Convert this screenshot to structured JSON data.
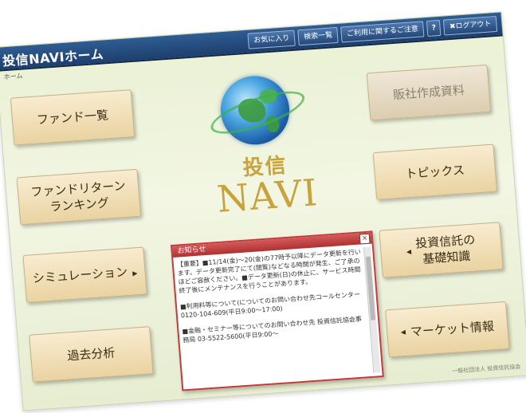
{
  "app": {
    "title": "投信NAVIホーム",
    "breadcrumb": "ホーム"
  },
  "toolbar": {
    "items": [
      {
        "label": "お気に入り"
      },
      {
        "label": "検索一覧"
      },
      {
        "label": "ご利用に関するご注意"
      },
      {
        "label": "?"
      },
      {
        "label": "✖ログアウト"
      }
    ]
  },
  "left_menu": [
    {
      "label": "ファンド一覧"
    },
    {
      "label": "ファンドリターン\nランキング"
    },
    {
      "label": "シミュレーション"
    },
    {
      "label": "過去分析"
    }
  ],
  "right_menu": [
    {
      "label": "販社作成資料"
    },
    {
      "label": "トピックス"
    },
    {
      "label": "投資信託の\n基礎知識"
    },
    {
      "label": "マーケット情報"
    }
  ],
  "logo": {
    "jp": "投信",
    "en": "NAVI"
  },
  "notice": {
    "title": "お知らせ",
    "close": "×",
    "paragraphs": [
      "【重要】■11/14(金)～20(金)の77時予以降にデータ更新を行います。データ更新完了にて(閲覧)などなる時間が発生、ご了承のほどご容赦ください。■データ更新(日)の休止に、サービス時間終了後にメンテナンスを行うことがあります。",
      "■利用料等について(についてのお問い合わせ先コールセンター 0120-104-609(平日9:00～17:00)",
      "■金融・セミナー等についてのお問い合わせ先 投資信託協会事務局 03-5522-5600(平日9:00～"
    ]
  },
  "footer": {
    "text": "一般社団法人 投資信託協会"
  }
}
